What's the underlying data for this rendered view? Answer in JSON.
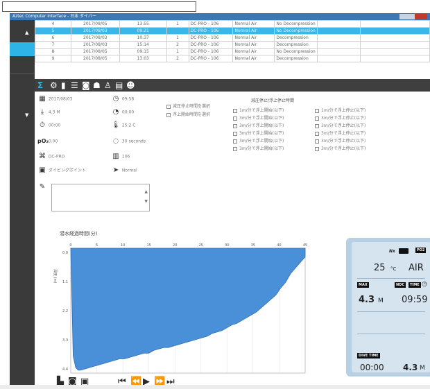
{
  "window": {
    "title": "Aztec Computer Interface - 日本 ダイバー"
  },
  "left_nav": {
    "arrow_up": "▲",
    "arrow_down": "▼"
  },
  "dive_table": {
    "rows": [
      {
        "idx": "4",
        "date": "2017/08/05",
        "time": "13:55",
        "num": "1",
        "model": "DC-PRO - 106",
        "gas": "Normal Air",
        "deco": "No Decompression",
        "selected": false
      },
      {
        "idx": "5",
        "date": "2017/08/03",
        "time": "09:21",
        "num": "",
        "model": "DC-PRO - 106",
        "gas": "Normal Air",
        "deco": "No Decompression",
        "selected": true
      },
      {
        "idx": "6",
        "date": "2017/08/03",
        "time": "10:37",
        "num": "1",
        "model": "DC-PRO - 106",
        "gas": "Normal Air",
        "deco": "Decompression",
        "selected": false
      },
      {
        "idx": "7",
        "date": "2017/08/03",
        "time": "15:14",
        "num": "2",
        "model": "DC-PRO - 106",
        "gas": "Normal Air",
        "deco": "Decompression",
        "selected": false
      },
      {
        "idx": "8",
        "date": "2017/08/05",
        "time": "09:15",
        "num": "1",
        "model": "DC-PRO - 106",
        "gas": "Normal Air",
        "deco": "No Decompression",
        "selected": false
      },
      {
        "idx": "9",
        "date": "2017/08/05",
        "time": "13:03",
        "num": "2",
        "model": "DC-PRO - 106",
        "gas": "Normal Air",
        "deco": "Decompression",
        "selected": false
      }
    ]
  },
  "toolbar": {
    "icons": [
      "sigma-icon",
      "gauge-icon",
      "tank-icon",
      "list-icon",
      "camera-icon",
      "buddy-icon",
      "compass-icon",
      "book-icon",
      "group-icon"
    ]
  },
  "dive_info": {
    "date": "2017/08/03",
    "time": "09:58",
    "max_depth": "4.3 M",
    "dive_time": "00:00",
    "interval": "00:00",
    "temp": "25.2 C",
    "po2": "0.00",
    "sample": "30 seconds",
    "computer": "DC-PRO",
    "serial": "106",
    "location": "ダイビングポイント",
    "gas": "Normal",
    "options_left": [
      "減圧停止時間を選択",
      "浮上開始時間を選択"
    ],
    "options_header": "減圧停止/浮上停止時間",
    "options_col1": [
      "1m/分で浮上開始(以下)",
      "3m/分で浮上開始(以下)",
      "3m/分で浮上開始(以下)",
      "3m/分で浮上開始(以下)",
      "3m/分で浮上開始(以下)",
      "3m/分で浮上開始(以下)"
    ],
    "options_col2": [
      "1m/分で浮上停止(以下)",
      "3m/分で浮上停止(以下)",
      "3m/分で浮上停止(以下)",
      "3m/分で浮上停止(以下)",
      "3m/分で浮上停止(以下)",
      "3m/分で浮上停止(以下)"
    ]
  },
  "chart_data": {
    "type": "area",
    "title": "潜水経過時間(分)",
    "ylabel": "深度 (m)",
    "x_ticks": [
      "0",
      "5",
      "10",
      "15",
      "20",
      "25",
      "30",
      "35",
      "40",
      "45"
    ],
    "y_ticks": [
      "0.0",
      "1.1",
      "2.2",
      "3.3",
      "4.4"
    ],
    "xlim": [
      0,
      48
    ],
    "ylim": [
      0,
      4.4
    ],
    "fill_color": "#4a90d9",
    "x": [
      0,
      0.5,
      1,
      1.5,
      2,
      3,
      4,
      5,
      6,
      7,
      8,
      9,
      10,
      11,
      12,
      13,
      14,
      15,
      16,
      17,
      18,
      19,
      20,
      21,
      22,
      23,
      24,
      25,
      26,
      27,
      28,
      29,
      30,
      31,
      32,
      33,
      34,
      35,
      36,
      37,
      38,
      39,
      40,
      41,
      42,
      43,
      44,
      45,
      46,
      47,
      48
    ],
    "y": [
      0.0,
      3.8,
      4.2,
      4.3,
      4.3,
      4.25,
      4.2,
      4.15,
      4.1,
      4.05,
      4.0,
      3.95,
      3.9,
      3.9,
      3.85,
      3.8,
      3.75,
      3.7,
      3.7,
      3.6,
      3.55,
      3.5,
      3.5,
      3.45,
      3.4,
      3.35,
      3.3,
      3.25,
      3.2,
      3.15,
      3.1,
      3.0,
      2.95,
      2.9,
      2.8,
      2.7,
      2.65,
      2.55,
      2.45,
      2.35,
      2.25,
      2.1,
      1.95,
      1.8,
      1.65,
      1.4,
      1.2,
      0.9,
      0.7,
      0.5,
      0.3
    ]
  },
  "dive_computer": {
    "mode": "Nx",
    "battery": "battery-icon",
    "po2_label": "PO2",
    "temp_value": "25",
    "temp_unit": "°C",
    "gas_mode": "AIR",
    "max_label": "MAX",
    "ndc_label": "NDC",
    "time_label": "TIME",
    "max_value": "4.3",
    "max_unit": "M",
    "ndc_value": "09:59",
    "dive_time_label": "DIVE TIME",
    "dive_time_value": "00:00",
    "depth_value": "4.3",
    "depth_unit": "M"
  },
  "playback": {
    "icons": [
      "first-icon",
      "rewind-icon",
      "play-icon",
      "fast-forward-icon",
      "last-icon"
    ]
  }
}
